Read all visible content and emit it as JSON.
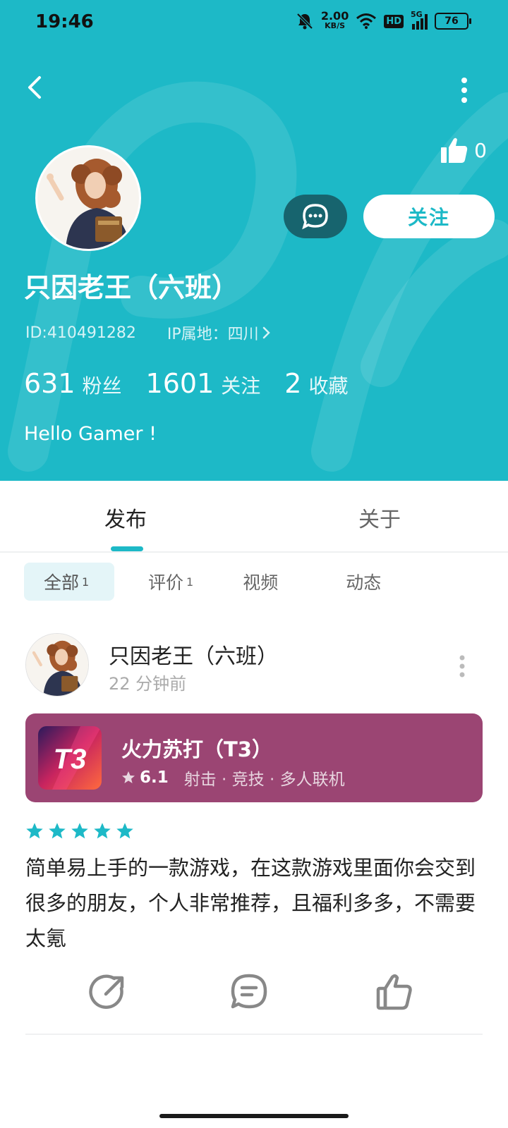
{
  "status_bar": {
    "time": "19:46",
    "net_speed": "2.00",
    "net_unit": "KB/S",
    "hd": "HD",
    "signal": "5G",
    "battery": "76"
  },
  "header": {
    "likes_count": "0",
    "follow_label": "关注",
    "username": "只因老王（六班）",
    "id_text": "ID:410491282",
    "ip_text": "IP属地：四川",
    "stats": [
      {
        "num": "631",
        "label": "粉丝"
      },
      {
        "num": "1601",
        "label": "关注"
      },
      {
        "num": "2",
        "label": "收藏"
      }
    ],
    "bio": "Hello Gamer !"
  },
  "tabs": [
    {
      "label": "发布"
    },
    {
      "label": "关于"
    }
  ],
  "filters": [
    {
      "label": "全部",
      "count": "1"
    },
    {
      "label": "评价",
      "count": "1"
    },
    {
      "label": "视频",
      "count": ""
    },
    {
      "label": "动态",
      "count": ""
    }
  ],
  "post": {
    "author": "只因老王（六班）",
    "time": "22 分钟前",
    "game": {
      "name": "火力苏打（T3）",
      "icon_text": "T3",
      "score": "6.1",
      "tags": "射击 · 竞技 · 多人联机"
    },
    "rating_stars": 5,
    "review": "简单易上手的一款游戏，在这款游戏里面你会交到很多的朋友，个人非常推荐，且福利多多，不需要太氪"
  },
  "colors": {
    "accent": "#1db9c7",
    "chat_button": "#17646e",
    "game_card": "#9b4573"
  }
}
